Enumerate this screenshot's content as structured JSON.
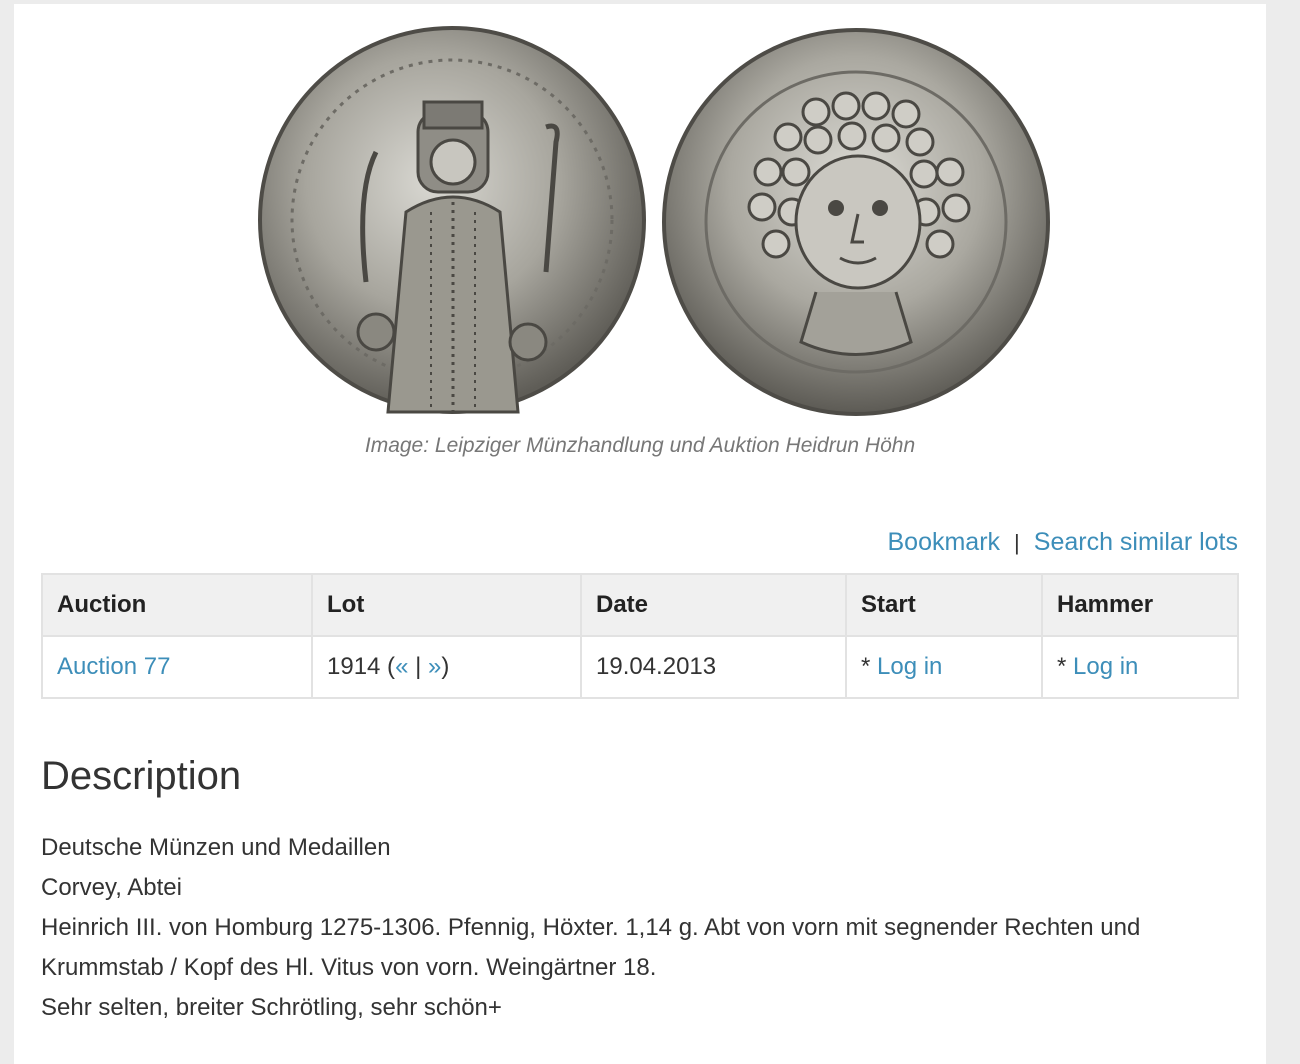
{
  "image": {
    "caption": "Image: Leipziger Münzhandlung und Auktion Heidrun Höhn"
  },
  "actions": {
    "bookmark": "Bookmark",
    "separator": "|",
    "search_similar": "Search similar lots"
  },
  "table": {
    "headers": [
      "Auction",
      "Lot",
      "Date",
      "Start",
      "Hammer"
    ],
    "row": {
      "auction": "Auction 77",
      "lot_number": "1914",
      "lot_prev": "«",
      "lot_sep": "|",
      "lot_next": "»",
      "date": "19.04.2013",
      "start_prefix": "*",
      "start_link": "Log in",
      "hammer_prefix": "*",
      "hammer_link": "Log in"
    }
  },
  "description": {
    "title": "Description",
    "lines": [
      "Deutsche Münzen und Medaillen",
      "Corvey, Abtei",
      "Heinrich III. von Homburg 1275-1306. Pfennig, Höxter. 1,14 g. Abt von vorn mit segnender Rechten und Krummstab / Kopf des Hl. Vitus von vorn. Weingärtner 18.",
      "Sehr selten, breiter Schrötling, sehr schön+"
    ]
  }
}
